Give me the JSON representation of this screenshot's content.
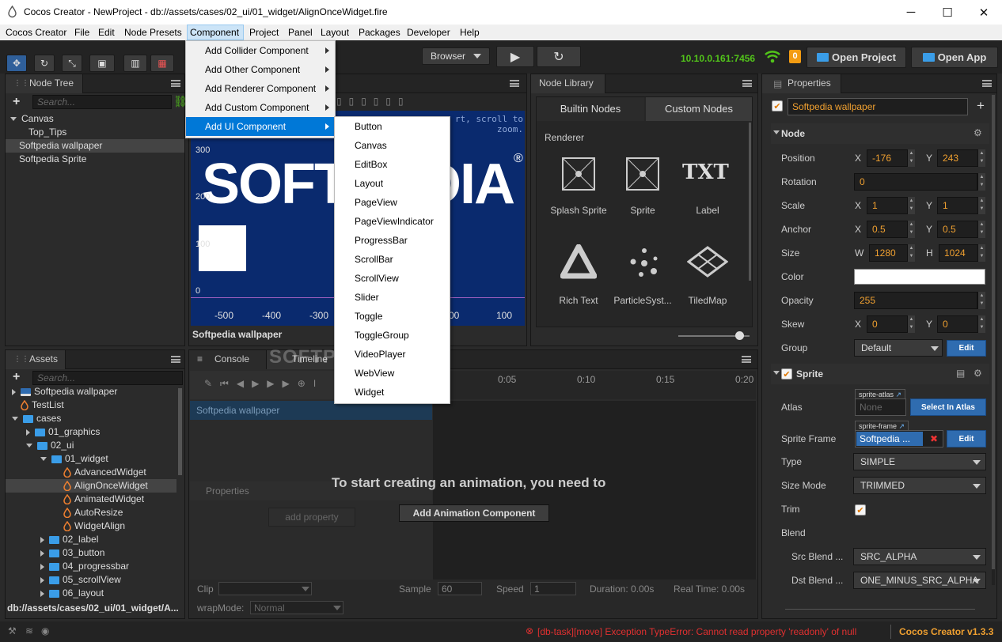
{
  "window": {
    "title": "Cocos Creator - NewProject - db://assets/cases/02_ui/01_widget/AlignOnceWidget.fire",
    "minimize": "─",
    "maximize": "☐",
    "close": "✕"
  },
  "menubar": [
    "Cocos Creator",
    "File",
    "Edit",
    "Node Presets",
    "Component",
    "Project",
    "Panel",
    "Layout",
    "Packages",
    "Developer",
    "Help"
  ],
  "toolbar": {
    "browser_select": "Browser",
    "ip": "10.10.0.161:7456",
    "notification_count": "0",
    "open_project": "Open Project",
    "open_app": "Open App"
  },
  "component_menu": {
    "items": [
      "Add Collider Component",
      "Add Other Component",
      "Add Renderer Component",
      "Add Custom Component",
      "Add UI Component"
    ],
    "active_index": 4
  },
  "ui_submenu": {
    "items": [
      "Button",
      "Canvas",
      "EditBox",
      "Layout",
      "PageView",
      "PageViewIndicator",
      "ProgressBar",
      "ScrollBar",
      "ScrollView",
      "Slider",
      "Toggle",
      "ToggleGroup",
      "VideoPlayer",
      "WebView",
      "Widget"
    ]
  },
  "node_tree": {
    "tab": "Node Tree",
    "search_placeholder": "Search...",
    "items": [
      {
        "label": "Canvas",
        "depth": 0,
        "expanded": true,
        "selected": false
      },
      {
        "label": "Top_Tips",
        "depth": 1,
        "expanded": false,
        "selected": false
      },
      {
        "label": "Softpedia wallpaper",
        "depth": 0,
        "expanded": false,
        "selected": true
      },
      {
        "label": "Softpedia Sprite",
        "depth": 0,
        "expanded": false,
        "selected": false
      }
    ]
  },
  "scene": {
    "hint": "rt, scroll to\nzoom.",
    "wallpaper_text": "SOFTPEDIA",
    "registered_mark": "®",
    "y_ticks": [
      "300",
      "200",
      "100",
      "0"
    ],
    "x_ticks": [
      "-500",
      "-400",
      "-300",
      "00",
      "100"
    ],
    "footer_label": "Softpedia wallpaper"
  },
  "node_library": {
    "tab": "Node Library",
    "tabs": [
      "Builtin Nodes",
      "Custom Nodes"
    ],
    "section": "Renderer",
    "items": [
      {
        "label": "Splash Sprite",
        "icon": "splash-sprite-icon"
      },
      {
        "label": "Sprite",
        "icon": "sprite-icon"
      },
      {
        "label": "Label",
        "icon": "label-icon",
        "glyph": "TXT"
      },
      {
        "label": "Rich Text",
        "icon": "rich-text-icon"
      },
      {
        "label": "ParticleSyst...",
        "icon": "particle-system-icon"
      },
      {
        "label": "TiledMap",
        "icon": "tiled-map-icon"
      }
    ],
    "zoom_level": 0.85
  },
  "properties": {
    "tab": "Properties",
    "node_name": "Softpedia wallpaper",
    "node_section": "Node",
    "position": {
      "label": "Position",
      "x": "-176",
      "y": "243"
    },
    "rotation": {
      "label": "Rotation",
      "value": "0"
    },
    "scale": {
      "label": "Scale",
      "x": "1",
      "y": "1"
    },
    "anchor": {
      "label": "Anchor",
      "x": "0.5",
      "y": "0.5"
    },
    "size": {
      "label": "Size",
      "w": "1280",
      "h": "1024"
    },
    "color": {
      "label": "Color",
      "value": "#ffffff"
    },
    "opacity": {
      "label": "Opacity",
      "value": "255"
    },
    "skew": {
      "label": "Skew",
      "x": "0",
      "y": "0"
    },
    "group": {
      "label": "Group",
      "value": "Default",
      "edit": "Edit"
    },
    "x_lbl": "X",
    "y_lbl": "Y",
    "w_lbl": "W",
    "h_lbl": "H",
    "sprite_section": "Sprite",
    "atlas": {
      "label": "Atlas",
      "tag": "sprite-atlas",
      "value": "None",
      "button": "Select In Atlas"
    },
    "sprite_frame": {
      "label": "Sprite Frame",
      "tag": "sprite-frame",
      "value": "Softpedia ...",
      "button": "Edit"
    },
    "type": {
      "label": "Type",
      "value": "SIMPLE"
    },
    "size_mode": {
      "label": "Size Mode",
      "value": "TRIMMED"
    },
    "trim": {
      "label": "Trim",
      "checked": true
    },
    "blend": {
      "label": "Blend"
    },
    "src_blend": {
      "label": "Src Blend ...",
      "value": "SRC_ALPHA"
    },
    "dst_blend": {
      "label": "Dst Blend ...",
      "value": "ONE_MINUS_SRC_ALPHA"
    }
  },
  "assets": {
    "tab": "Assets",
    "search_placeholder": "Search...",
    "items": [
      {
        "label": "Softpedia wallpaper",
        "depth": 1,
        "kind": "image",
        "arrow": "right"
      },
      {
        "label": "TestList",
        "depth": 1,
        "kind": "fire",
        "arrow": "none"
      },
      {
        "label": "cases",
        "depth": 1,
        "kind": "folder",
        "arrow": "down"
      },
      {
        "label": "01_graphics",
        "depth": 2,
        "kind": "folder",
        "arrow": "right"
      },
      {
        "label": "02_ui",
        "depth": 2,
        "kind": "folder",
        "arrow": "down"
      },
      {
        "label": "01_widget",
        "depth": 3,
        "kind": "folder",
        "arrow": "down"
      },
      {
        "label": "AdvancedWidget",
        "depth": 4,
        "kind": "fire",
        "arrow": "none"
      },
      {
        "label": "AlignOnceWidget",
        "depth": 4,
        "kind": "fire",
        "arrow": "none",
        "selected": true
      },
      {
        "label": "AnimatedWidget",
        "depth": 4,
        "kind": "fire",
        "arrow": "none"
      },
      {
        "label": "AutoResize",
        "depth": 4,
        "kind": "fire",
        "arrow": "none"
      },
      {
        "label": "WidgetAlign",
        "depth": 4,
        "kind": "fire",
        "arrow": "none"
      },
      {
        "label": "02_label",
        "depth": 3,
        "kind": "folder",
        "arrow": "right"
      },
      {
        "label": "03_button",
        "depth": 3,
        "kind": "folder",
        "arrow": "right"
      },
      {
        "label": "04_progressbar",
        "depth": 3,
        "kind": "folder",
        "arrow": "right"
      },
      {
        "label": "05_scrollView",
        "depth": 3,
        "kind": "folder",
        "arrow": "right"
      },
      {
        "label": "06_layout",
        "depth": 3,
        "kind": "folder",
        "arrow": "right"
      }
    ],
    "footer_path": "db://assets/cases/02_ui/01_widget/A..."
  },
  "timeline": {
    "tabs": [
      "Console",
      "Timeline"
    ],
    "ticks": [
      "0:05",
      "0:10",
      "0:15",
      "0:20"
    ],
    "track": "Softpedia wallpaper",
    "properties_label": "Properties",
    "add_property": "add property",
    "message": "To start creating an animation, you need to",
    "add_animation": "Add Animation Component",
    "clip_label": "Clip",
    "sample_label": "Sample",
    "sample_value": "60",
    "speed_label": "Speed",
    "speed_value": "1",
    "duration": "Duration: 0.00s",
    "real_time": "Real Time: 0.00s",
    "wrapmode_label": "wrapMode:",
    "wrapmode_value": "Normal"
  },
  "watermark": "SOFTPEDIA",
  "statusbar": {
    "error": "[db-task][move] Exception TypeError: Cannot read property 'readonly' of null",
    "version": "Cocos Creator v1.3.3"
  }
}
